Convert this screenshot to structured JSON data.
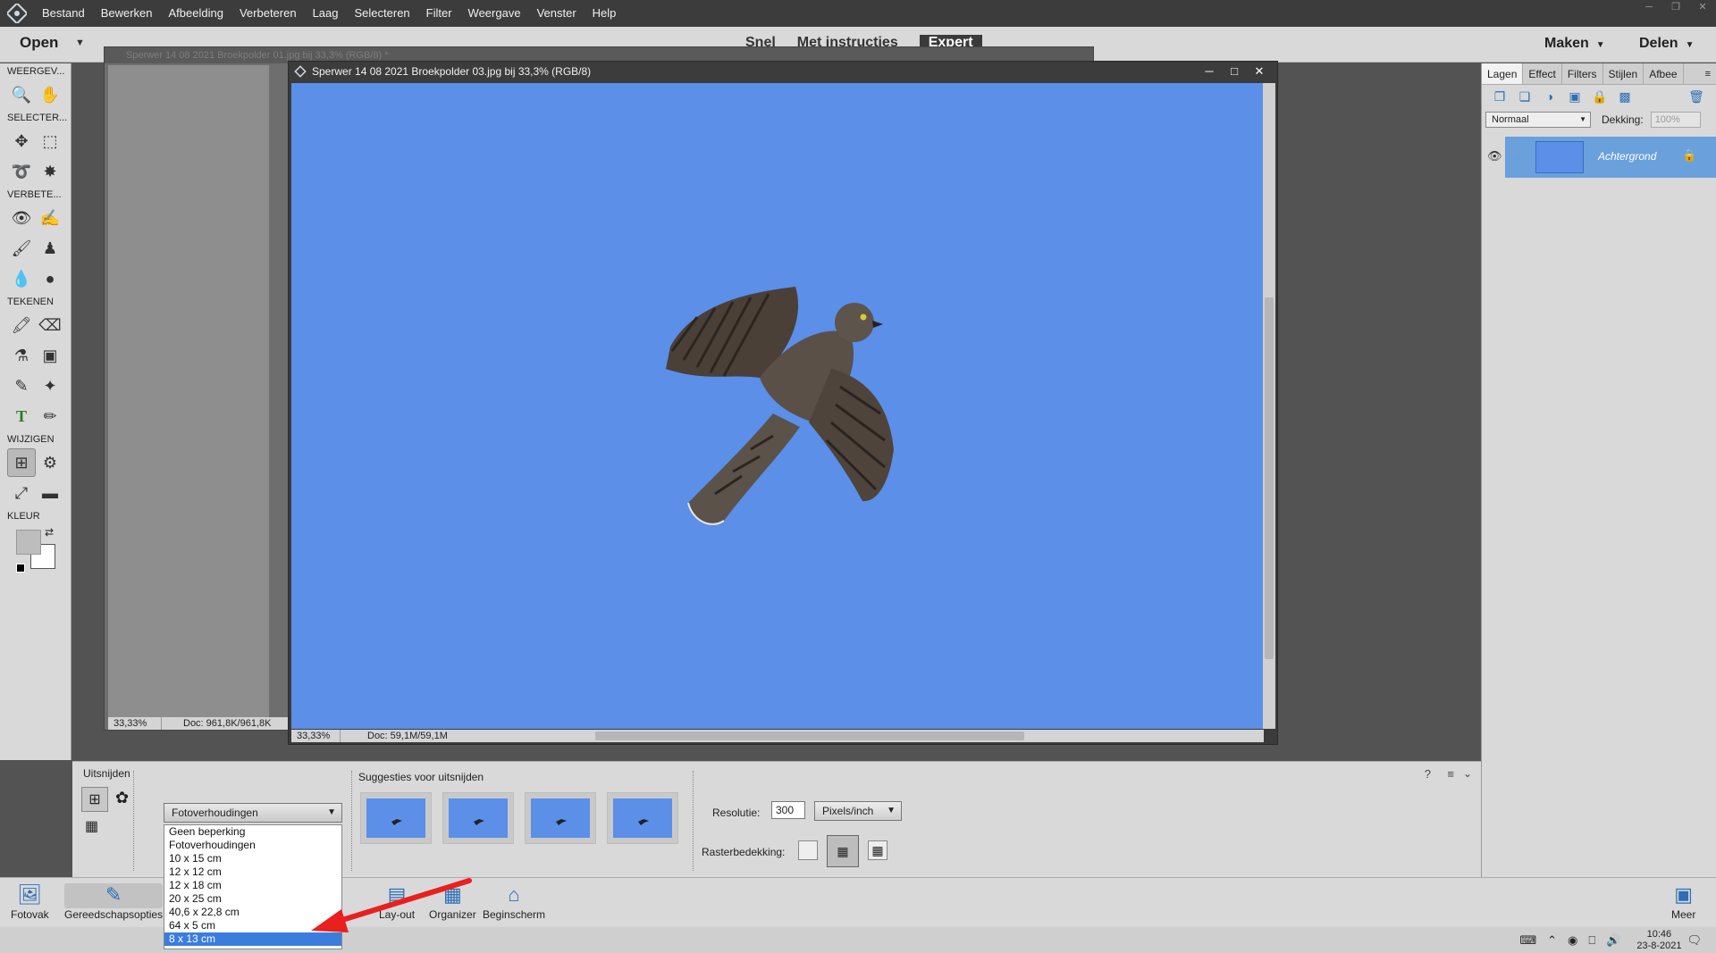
{
  "menubar": {
    "items": [
      "Bestand",
      "Bewerken",
      "Afbeelding",
      "Verbeteren",
      "Laag",
      "Selecteren",
      "Filter",
      "Weergave",
      "Venster",
      "Help"
    ]
  },
  "topbar": {
    "open_label": "Open",
    "mode_tabs": [
      "Snel",
      "Met instructies",
      "Expert"
    ],
    "active_mode": "Expert",
    "maken_label": "Maken",
    "delen_label": "Delen"
  },
  "toolbox": {
    "sections": [
      "WEERGEV...",
      "SELECTER...",
      "VERBETE...",
      "TEKENEN",
      "WIJZIGEN",
      "KLEUR"
    ]
  },
  "documents": {
    "back": {
      "title": "Sperwer 14 08 2021 Broekpolder 01.jpg bij 33,3% (RGB/8) *",
      "zoom": "33,33%",
      "doc_info": "Doc: 961,8K/961,8K"
    },
    "front": {
      "title": "Sperwer 14 08 2021 Broekpolder 03.jpg bij 33,3% (RGB/8)",
      "zoom": "33,33%",
      "doc_info": "Doc: 59,1M/59,1M"
    }
  },
  "tool_options": {
    "title": "Uitsnijden",
    "ratio_select_value": "Fotoverhoudingen",
    "ratio_options": [
      "Geen beperking",
      "Fotoverhoudingen",
      "10 x 15 cm",
      "12 x 12 cm",
      "12 x 18 cm",
      "20 x 25 cm",
      "40,6 x 22,8 cm",
      "64 x 5 cm",
      "8 x 13 cm"
    ],
    "ratio_highlighted": "8 x 13 cm",
    "suggestions_title": "Suggesties voor uitsnijden",
    "resolution_label": "Resolutie:",
    "resolution_value": "300",
    "resolution_unit": "Pixels/inch",
    "grid_label": "Rasterbedekking:"
  },
  "layers_panel": {
    "tabs": [
      "Lagen",
      "Effect",
      "Filters",
      "Stijlen",
      "Afbee"
    ],
    "active_tab": "Lagen",
    "blend_mode": "Normaal",
    "opacity_label": "Dekking:",
    "opacity_value": "100%",
    "layer_name": "Achtergrond"
  },
  "taskbar": {
    "buttons": [
      "Fotovak",
      "Gereedschapsopties",
      "Lay-out",
      "Organizer",
      "Beginscherm",
      "Meer"
    ]
  },
  "system_tray": {
    "time": "10:46",
    "date": "23-8-2021"
  },
  "colors": {
    "sky": "#5b8fe8",
    "menubar_bg": "#3c3c3c",
    "panel_bg": "#d9d9d9",
    "workspace_bg": "#535353",
    "annotation_arrow": "#e8201e",
    "highlight": "#3b7ddd"
  }
}
